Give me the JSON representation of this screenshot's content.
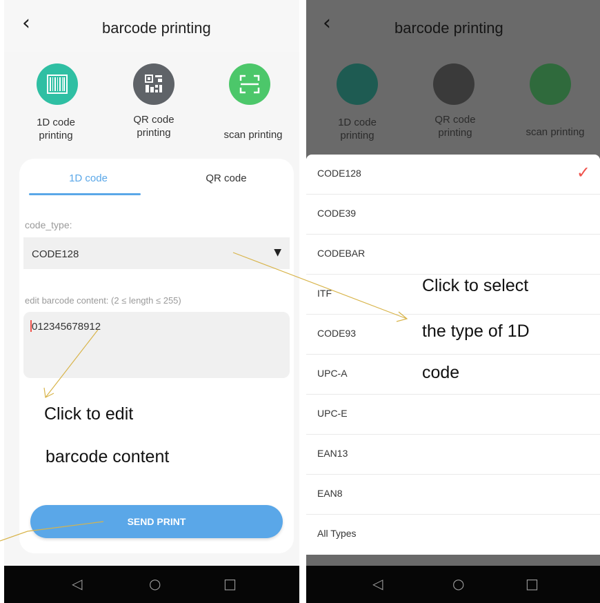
{
  "left_screen": {
    "back_icon": "chevron-left-icon",
    "title": "barcode printing",
    "modes": [
      {
        "label_line1": "1D code",
        "label_line2": "printing",
        "icon": "barcode-icon",
        "color": "#2fbfa3"
      },
      {
        "label_line1": "QR code",
        "label_line2": "printing",
        "icon": "qr-code-icon",
        "color": "#5f6368"
      },
      {
        "label_line1": "scan printing",
        "label_line2": "",
        "icon": "scan-frame-icon",
        "color": "#4cc76a"
      }
    ],
    "tabs": [
      {
        "label": "1D code",
        "active": true
      },
      {
        "label": "QR code",
        "active": false
      }
    ],
    "code_type_label": "code_type:",
    "code_type_value": "CODE128",
    "edit_label": "edit barcode content:  (2 ≤ length ≤ 255)",
    "content_value": "012345678912",
    "send_button": "SEND PRINT",
    "annotation_edit_line1": "Click to edit",
    "annotation_edit_line2": "barcode content",
    "accent_color": "#5aa7e8"
  },
  "right_screen": {
    "title": "barcode printing",
    "modes": [
      {
        "label_line1": "1D code",
        "label_line2": "printing"
      },
      {
        "label_line1": "QR code",
        "label_line2": "printing"
      },
      {
        "label_line1": "scan printing",
        "label_line2": ""
      }
    ],
    "options": [
      "CODE128",
      "CODE39",
      "CODEBAR",
      "ITF",
      "CODE93",
      "UPC-A",
      "UPC-E",
      "EAN13",
      "EAN8",
      "All Types"
    ],
    "selected_option": "CODE128",
    "check_color": "#f0524b",
    "annotation_select_line1": "Click to select",
    "annotation_select_line2": "the type of 1D",
    "annotation_select_line3": "code"
  },
  "nav_icons": [
    "back-triangle-icon",
    "home-circle-icon",
    "recents-square-icon"
  ]
}
